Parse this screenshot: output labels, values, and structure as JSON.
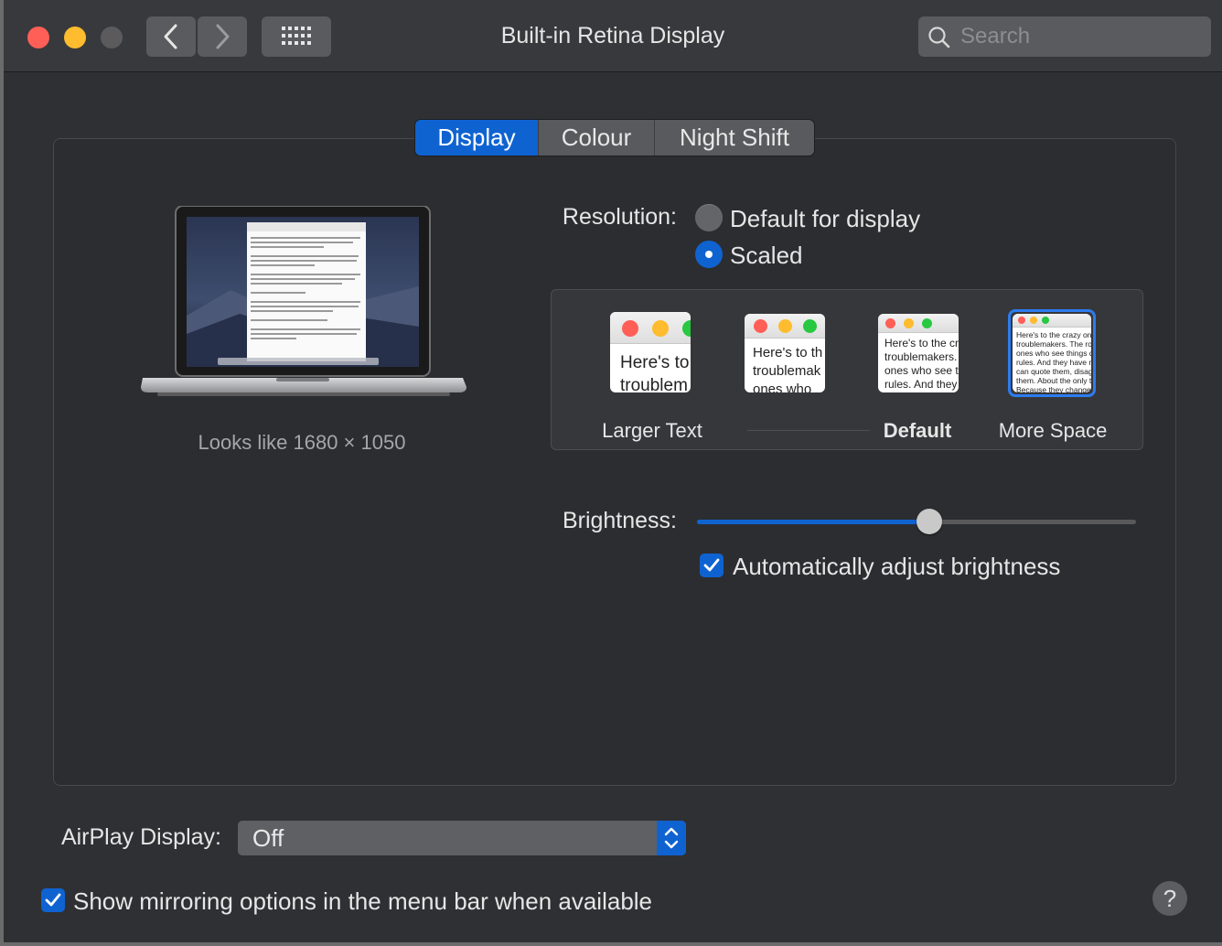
{
  "window": {
    "title": "Built-in Retina Display"
  },
  "search": {
    "placeholder": "Search"
  },
  "tabs": [
    {
      "label": "Display",
      "active": true
    },
    {
      "label": "Colour",
      "active": false
    },
    {
      "label": "Night Shift",
      "active": false
    }
  ],
  "preview": {
    "looks_like": "Looks like 1680 × 1050"
  },
  "resolution": {
    "label": "Resolution:",
    "options": [
      {
        "label": "Default for display",
        "selected": false
      },
      {
        "label": "Scaled",
        "selected": true
      }
    ]
  },
  "scaled_options": [
    {
      "label": "Larger Text",
      "preview_text": "Here's to\ntroublem",
      "selected": false
    },
    {
      "label": "",
      "preview_text": "Here's to th\ntroublemak\nones who",
      "selected": false
    },
    {
      "label": "Default",
      "preview_text": "Here's to the cr\ntroublemakers.\nones who see t\nrules. And they",
      "selected": false
    },
    {
      "label": "More Space",
      "preview_text": "Here's to the crazy one\ntroublemakers. The rou\nones who see things di\nrules. And they have no\ncan quote them, disagre\nthem. About the only th\nBecause they change t",
      "selected": true
    }
  ],
  "brightness": {
    "label": "Brightness:",
    "level": 0.53
  },
  "auto_brightness": {
    "label": "Automatically adjust brightness",
    "checked": true
  },
  "airplay": {
    "label": "AirPlay Display:",
    "value": "Off"
  },
  "mirroring": {
    "label": "Show mirroring options in the menu bar when available",
    "checked": true
  },
  "help": {
    "label": "?"
  },
  "colors": {
    "accent": "#0f63d1",
    "close": "#ff5f57",
    "minimize": "#febc2e"
  }
}
